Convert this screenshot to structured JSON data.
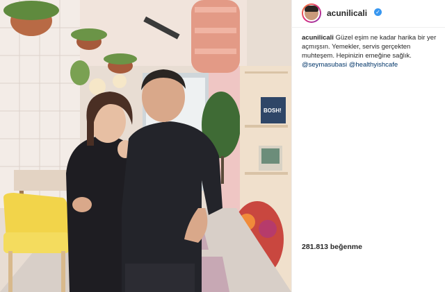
{
  "header": {
    "username": "acunilicali",
    "verified_icon": "verified-badge-icon"
  },
  "caption": {
    "username": "acunilicali",
    "text": "Güzel eşim ne kadar harika bir yer açmışsın. Yemekler, servis gerçekten muhteşem. Hepinizin emeğine sağlık.",
    "mention_1": "@seymasubasi",
    "mention_2": "@healthyishcafe"
  },
  "likes": "281.813 beğenme",
  "photo": {
    "book_title": "BOSH!"
  },
  "colors": {
    "link": "#003569",
    "verified": "#3897f0",
    "chair": "#f2d44a",
    "wall_pink": "#efc6c4"
  }
}
